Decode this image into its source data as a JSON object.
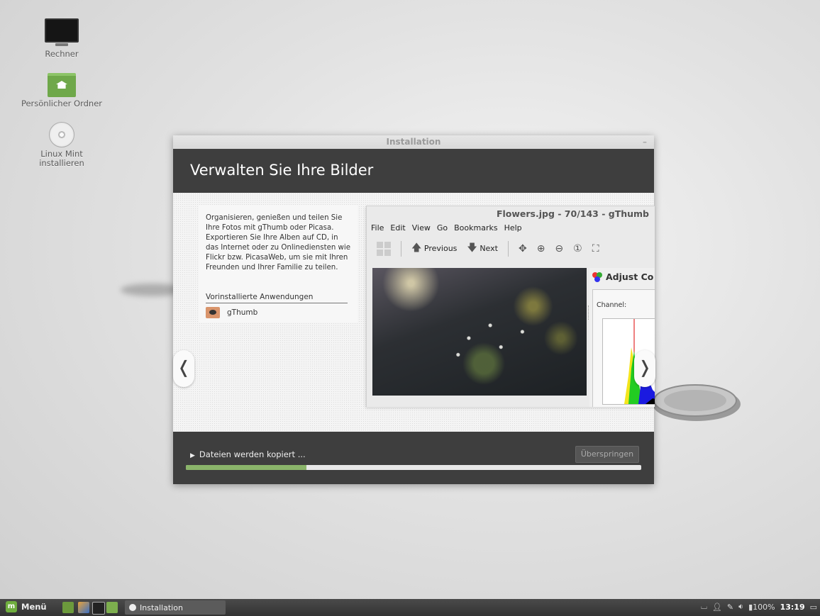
{
  "desktop": {
    "icons": [
      {
        "label": "Rechner",
        "icon": "computer-icon"
      },
      {
        "label": "Persönlicher Ordner",
        "icon": "home-folder-icon"
      },
      {
        "label_line1": "Linux Mint",
        "label_line2": "installieren",
        "icon": "disc-icon"
      }
    ]
  },
  "window": {
    "title": "Installation",
    "minimize": "–",
    "header": "Verwalten Sie Ihre Bilder",
    "description": "Organisieren, genießen und teilen Sie Ihre Fotos mit gThumb oder Picasa. Exportieren Sie Ihre Alben auf CD, in das Internet oder zu Onlinediensten wie Flickr bzw. PicasaWeb, um sie mit Ihren Freunden und Ihrer Familie zu teilen.",
    "apps_heading": "Vorinstallierte Anwendungen",
    "app_name": "gThumb",
    "prev_arrow": "❬",
    "next_arrow": "❭",
    "status": "Dateien werden kopiert ...",
    "skip_label": "Überspringen",
    "progress": 0.265
  },
  "gthumb": {
    "title": "Flowers.jpg - 70/143 - gThumb",
    "menu": [
      "File",
      "Edit",
      "View",
      "Go",
      "Bookmarks",
      "Help"
    ],
    "previous": "Previous",
    "next": "Next",
    "panel_title": "Adjust Co",
    "channel_label": "Channel:"
  },
  "taskbar": {
    "menu_label": "Menü",
    "task_label": "Installation",
    "battery": "100%",
    "clock": "13:19"
  },
  "colors": {
    "accent": "#8ab46a",
    "header_bg": "#3e3e3e",
    "mint_green": "#6fae3e"
  }
}
